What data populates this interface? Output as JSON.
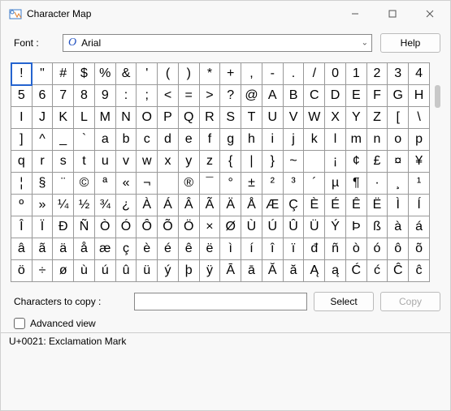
{
  "titlebar": {
    "title": "Character Map"
  },
  "font_row": {
    "label": "Font :",
    "font_name": "Arial",
    "help_label": "Help"
  },
  "copy_row": {
    "label": "Characters to copy :",
    "value": "",
    "select_label": "Select",
    "copy_label": "Copy"
  },
  "advanced": {
    "label": "Advanced view",
    "checked": false
  },
  "status": "U+0021: Exclamation Mark",
  "selected_index": 0,
  "grid": [
    [
      "!",
      "\"",
      "#",
      "$",
      "%",
      "&",
      "'",
      "(",
      ")",
      "*",
      "+",
      ",",
      "-",
      ".",
      "/",
      "0",
      "1",
      "2",
      "3",
      "4"
    ],
    [
      "5",
      "6",
      "7",
      "8",
      "9",
      ":",
      ";",
      "<",
      "=",
      ">",
      "?",
      "@",
      "A",
      "B",
      "C",
      "D",
      "E",
      "F",
      "G",
      "H"
    ],
    [
      "I",
      "J",
      "K",
      "L",
      "M",
      "N",
      "O",
      "P",
      "Q",
      "R",
      "S",
      "T",
      "U",
      "V",
      "W",
      "X",
      "Y",
      "Z",
      "[",
      "\\"
    ],
    [
      "]",
      "^",
      "_",
      "`",
      "a",
      "b",
      "c",
      "d",
      "e",
      "f",
      "g",
      "h",
      "i",
      "j",
      "k",
      "l",
      "m",
      "n",
      "o",
      "p"
    ],
    [
      "q",
      "r",
      "s",
      "t",
      "u",
      "v",
      "w",
      "x",
      "y",
      "z",
      "{",
      "|",
      "}",
      "~",
      " ",
      "¡",
      "¢",
      "£",
      "¤",
      "¥"
    ],
    [
      "¦",
      "§",
      "¨",
      "©",
      "ª",
      "«",
      "¬",
      "­",
      "®",
      "¯",
      "°",
      "±",
      "²",
      "³",
      "´",
      "µ",
      "¶",
      "·",
      "¸",
      "¹"
    ],
    [
      "º",
      "»",
      "¼",
      "½",
      "¾",
      "¿",
      "À",
      "Á",
      "Â",
      "Ã",
      "Ä",
      "Å",
      "Æ",
      "Ç",
      "È",
      "É",
      "Ê",
      "Ë",
      "Ì",
      "Í"
    ],
    [
      "Î",
      "Ï",
      "Đ",
      "Ñ",
      "Ò",
      "Ó",
      "Ô",
      "Õ",
      "Ö",
      "×",
      "Ø",
      "Ù",
      "Ú",
      "Û",
      "Ü",
      "Ý",
      "Þ",
      "ß",
      "à",
      "á"
    ],
    [
      "â",
      "ã",
      "ä",
      "å",
      "æ",
      "ç",
      "è",
      "é",
      "ê",
      "ë",
      "ì",
      "í",
      "î",
      "ï",
      "đ",
      "ñ",
      "ò",
      "ó",
      "ô",
      "õ"
    ],
    [
      "ö",
      "÷",
      "ø",
      "ù",
      "ú",
      "û",
      "ü",
      "ý",
      "þ",
      "ÿ",
      "Ā",
      "ā",
      "Ă",
      "ă",
      "Ą",
      "ą",
      "Ć",
      "ć",
      "Ĉ",
      "ĉ"
    ]
  ]
}
